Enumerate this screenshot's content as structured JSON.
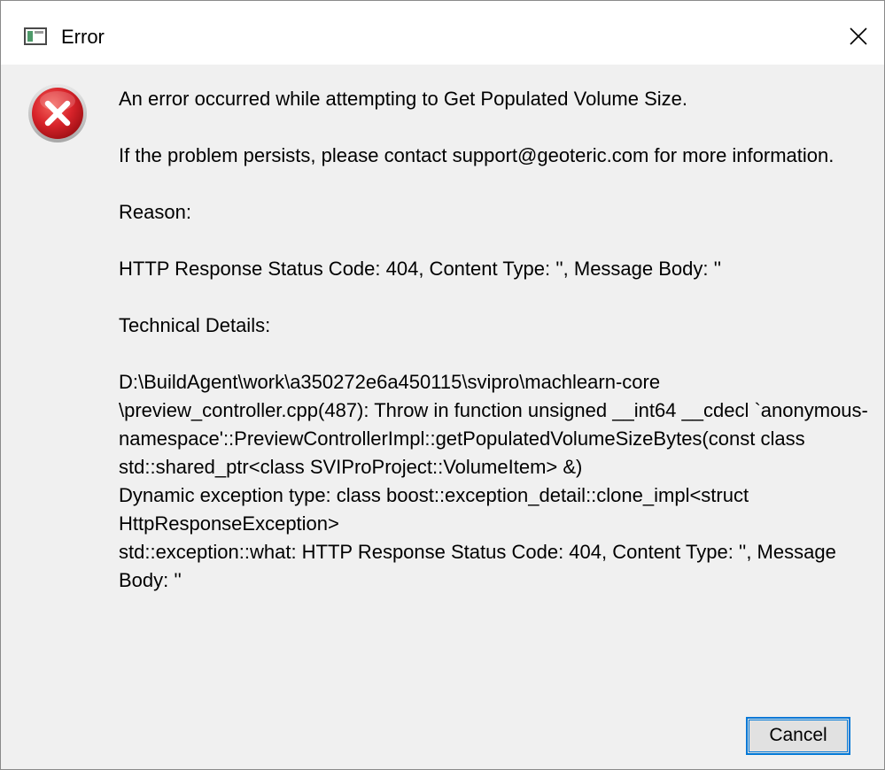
{
  "window": {
    "title": "Error",
    "app_icon": "application-window-icon",
    "close_icon": "close-icon"
  },
  "dialog": {
    "icon": "error-icon",
    "colors": {
      "error_red": "#d8232a",
      "accent_blue": "#0078d7",
      "background": "#f0f0f0"
    },
    "message": "An error occurred while attempting to Get Populated Volume Size.",
    "support": "If the problem persists, please contact support@geoteric.com for more information.",
    "reason_label": "Reason:",
    "reason": "HTTP Response Status Code: 404, Content Type: '', Message Body: ''",
    "technical_label": "Technical Details:",
    "technical_details": "D:\\BuildAgent\\work\\a350272e6a450115\\svipro\\machlearn-core\n\\preview_controller.cpp(487): Throw in function unsigned __int64 __cdecl `anonymous-namespace'::PreviewControllerImpl::getPopulatedVolumeSizeBytes(const class std::shared_ptr<class SVIProProject::VolumeItem> &)\nDynamic exception type: class boost::exception_detail::clone_impl<struct HttpResponseException>\nstd::exception::what: HTTP Response Status Code: 404, Content Type: '', Message Body: ''"
  },
  "buttons": {
    "cancel_label": "Cancel"
  }
}
